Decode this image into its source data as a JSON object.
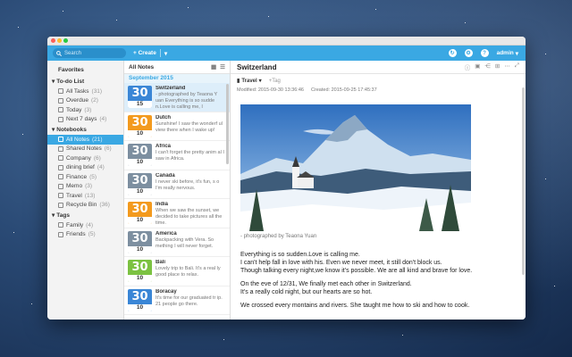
{
  "toolbar": {
    "search_placeholder": "Search",
    "create_label": "+ Create",
    "create_caret": "▾",
    "user_label": "admin",
    "user_caret": "▾",
    "icons": [
      "refresh-icon",
      "settings-icon",
      "help-icon"
    ]
  },
  "sidebar": {
    "favorites_label": "Favorites",
    "todo": {
      "label": "To-do List",
      "items": [
        {
          "label": "All Tasks",
          "count": "(31)"
        },
        {
          "label": "Overdue",
          "count": "(2)"
        },
        {
          "label": "Today",
          "count": "(3)"
        },
        {
          "label": "Next 7 days",
          "count": "(4)"
        }
      ]
    },
    "notebooks": {
      "label": "Notebooks",
      "items": [
        {
          "label": "All Notes",
          "count": "(21)",
          "active": true
        },
        {
          "label": "Shared Notes",
          "count": "(6)"
        },
        {
          "label": "Company",
          "count": "(6)"
        },
        {
          "label": "dining brief",
          "count": "(4)"
        },
        {
          "label": "Finance",
          "count": "(5)"
        },
        {
          "label": "Memo",
          "count": "(3)"
        },
        {
          "label": "Travel",
          "count": "(13)"
        },
        {
          "label": "Recycle Bin",
          "count": "(36)"
        }
      ]
    },
    "tags": {
      "label": "Tags",
      "items": [
        {
          "label": "Family",
          "count": "(4)"
        },
        {
          "label": "Friends",
          "count": "(5)"
        }
      ]
    }
  },
  "notes_list": {
    "header": "All Notes",
    "month": "September 2015",
    "colors": {
      "blue": "#3a86d6",
      "orange": "#f39a1e",
      "green": "#7cc242",
      "photo": "#7d8fa0"
    },
    "notes": [
      {
        "day": "30",
        "mon": "15",
        "title": "Switzerland",
        "preview": "- photographed by Teaona Y uan Everything is so sudde n.Love is calling me, I",
        "style": "blue"
      },
      {
        "day": "30",
        "mon": "10",
        "title": "Dutch",
        "preview": "Sunshine! I saw the wonderf ul view there when I wake up!",
        "style": "orange"
      },
      {
        "day": "30",
        "mon": "10",
        "title": "Africa",
        "preview": "I can't forget the pretty anim al I saw in Africa.",
        "style": "photo"
      },
      {
        "day": "30",
        "mon": "10",
        "title": "Canada",
        "preview": "I never ski before, it's fun, s o I'm really nervous.",
        "style": "photo"
      },
      {
        "day": "30",
        "mon": "10",
        "title": "India",
        "preview": "When we saw the sunset, we decided to take pictures all the time.",
        "style": "orange"
      },
      {
        "day": "30",
        "mon": "10",
        "title": "America",
        "preview": "Backpacking with Vera. So mething I will never forget.",
        "style": "photo"
      },
      {
        "day": "30",
        "mon": "10",
        "title": "Bali",
        "preview": "Lovely trip to Bali. It's a real ly good place to relax.",
        "style": "green"
      },
      {
        "day": "30",
        "mon": "10",
        "title": "Boracay",
        "preview": "It's time for our graduated tr ip. 21 people go there.",
        "style": "blue"
      }
    ]
  },
  "editor": {
    "title": "Switzerland",
    "notebook": "Travel",
    "notebook_caret": "▾",
    "tag_placeholder": "+Tag",
    "modified_label": "Modified:",
    "modified": "2015-09-30 13:36:46",
    "created_label": "Created:",
    "created": "2015-09-25 17:45:37",
    "caption": "- photographed by Teaona Yuan",
    "paragraphs": [
      [
        "Everything is so sudden.Love is calling me.",
        "I can't help fall in love with his. Even we never meet, it still don't block us.",
        "Though talking every night,we know it's possible. We are all kind and brave for love."
      ],
      [
        "On the eve of 12/31, We finally met each other in Switzerland.",
        "It's a really cold night, but our hearts are so hot."
      ],
      [
        "We crossed every montains and rivers. She taught me how to ski and how to cook."
      ]
    ]
  }
}
